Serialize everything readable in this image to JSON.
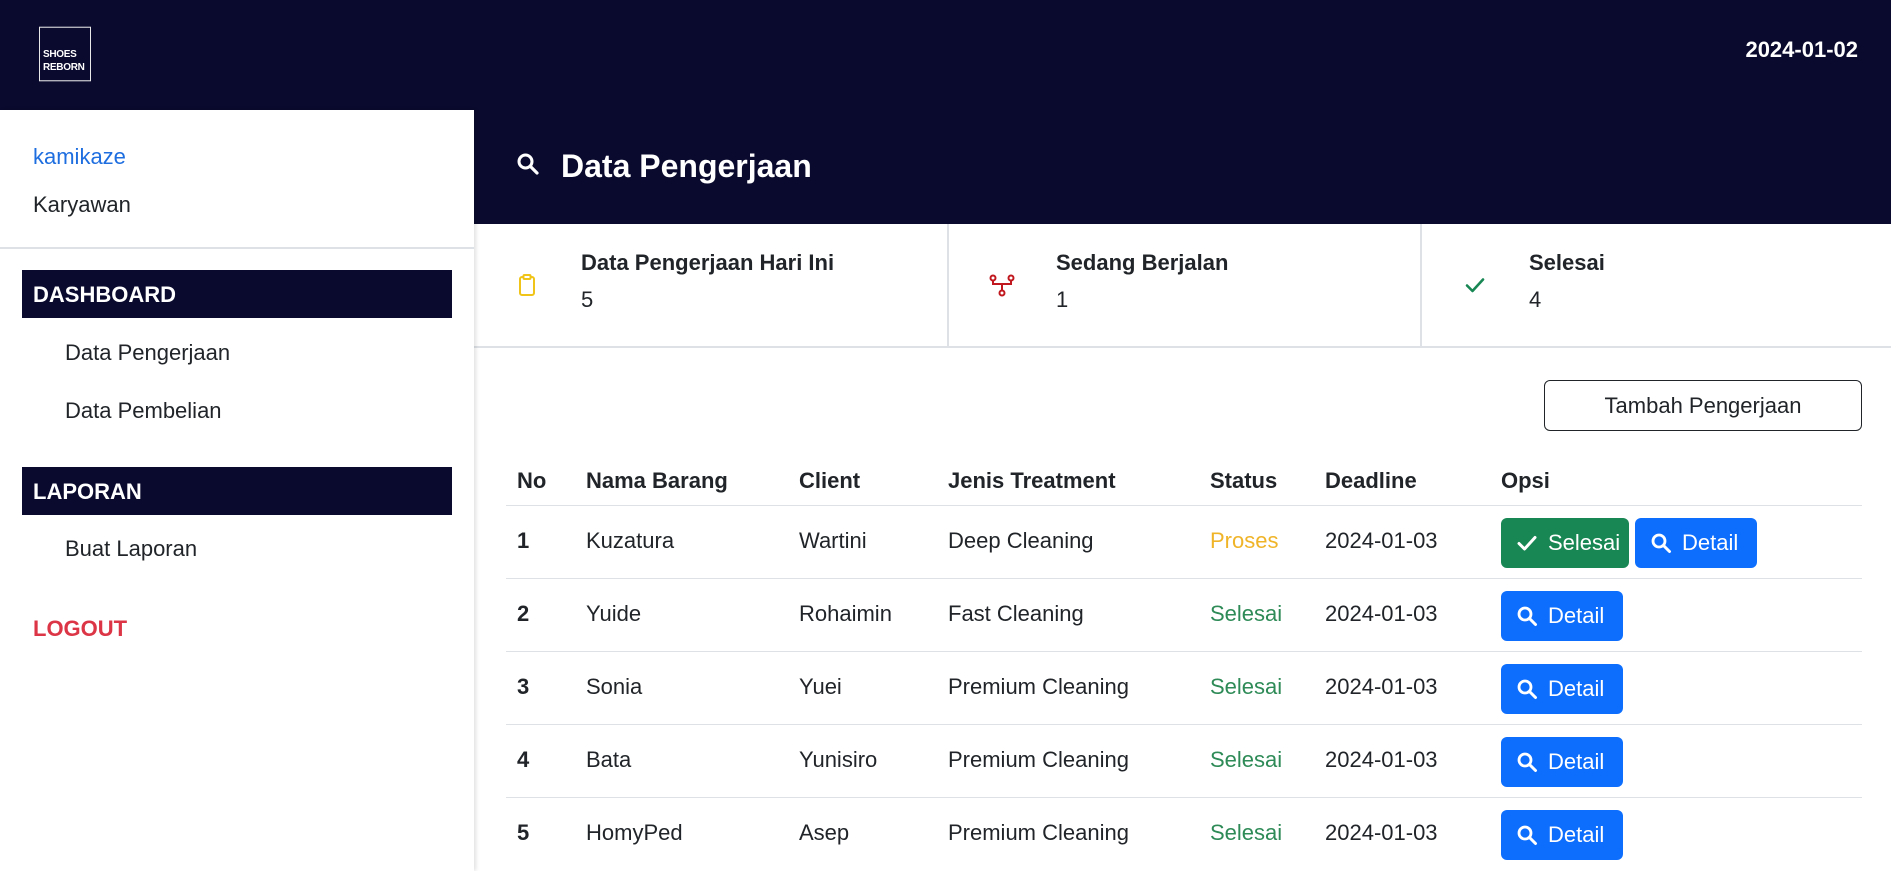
{
  "topbar": {
    "logo_line1": "SHOES",
    "logo_line2": "REBORN",
    "date": "2024-01-02"
  },
  "sidebar": {
    "user_name": "kamikaze",
    "user_role": "Karyawan",
    "dashboard_label": "DASHBOARD",
    "dashboard_items": [
      "Data Pengerjaan",
      "Data Pembelian"
    ],
    "laporan_label": "LAPORAN",
    "laporan_items": [
      "Buat Laporan"
    ],
    "logout_label": "LOGOUT"
  },
  "header": {
    "title": "Data Pengerjaan"
  },
  "stats": [
    {
      "label": "Data Pengerjaan Hari Ini",
      "value": "5",
      "icon": "clipboard-icon",
      "color": "#f0c419"
    },
    {
      "label": "Sedang Berjalan",
      "value": "1",
      "icon": "network-icon",
      "color": "#c0181e"
    },
    {
      "label": "Selesai",
      "value": "4",
      "icon": "check-icon",
      "color": "#198754"
    }
  ],
  "add_button_label": "Tambah Pengerjaan",
  "table": {
    "headers": [
      "No",
      "Nama Barang",
      "Client",
      "Jenis Treatment",
      "Status",
      "Deadline",
      "Opsi"
    ],
    "rows": [
      {
        "no": "1",
        "nama": "Kuzatura",
        "client": "Wartini",
        "jenis": "Deep Cleaning",
        "status": "Proses",
        "deadline": "2024-01-03"
      },
      {
        "no": "2",
        "nama": "Yuide",
        "client": "Rohaimin",
        "jenis": "Fast Cleaning",
        "status": "Selesai",
        "deadline": "2024-01-03"
      },
      {
        "no": "3",
        "nama": "Sonia",
        "client": "Yuei",
        "jenis": "Premium Cleaning",
        "status": "Selesai",
        "deadline": "2024-01-03"
      },
      {
        "no": "4",
        "nama": "Bata",
        "client": "Yunisiro",
        "jenis": "Premium Cleaning",
        "status": "Selesai",
        "deadline": "2024-01-03"
      },
      {
        "no": "5",
        "nama": "HomyPed",
        "client": "Asep",
        "jenis": "Premium Cleaning",
        "status": "Selesai",
        "deadline": "2024-01-03"
      }
    ],
    "selesai_button_label": "Selesai",
    "detail_button_label": "Detail"
  },
  "colors": {
    "navy": "#0a0a2e",
    "primary": "#0d6efd",
    "success": "#198754",
    "danger": "#dc3545",
    "warning": "#f0b429",
    "link": "#1e6ee0"
  }
}
